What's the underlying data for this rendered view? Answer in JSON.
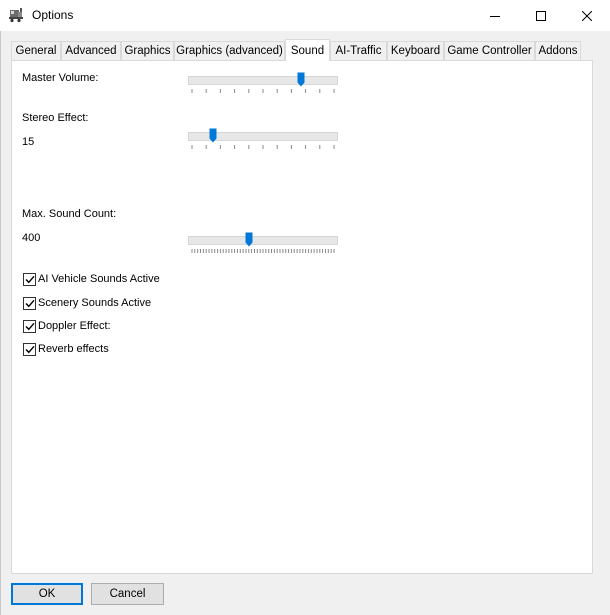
{
  "window": {
    "title": "Options",
    "app_icon": "train-icon",
    "controls": {
      "minimize_icon": "minimize-icon",
      "maximize_icon": "maximize-icon",
      "close_icon": "close-icon"
    }
  },
  "tabs": [
    {
      "label": "General",
      "active": false
    },
    {
      "label": "Advanced",
      "active": false
    },
    {
      "label": "Graphics",
      "active": false
    },
    {
      "label": "Graphics (advanced)",
      "active": false
    },
    {
      "label": "Sound",
      "active": true
    },
    {
      "label": "AI-Traffic",
      "active": false
    },
    {
      "label": "Keyboard",
      "active": false
    },
    {
      "label": "Game Controller",
      "active": false
    },
    {
      "label": "Addons",
      "active": false
    }
  ],
  "sound": {
    "master_volume": {
      "label": "Master Volume:",
      "level": 0.77
    },
    "stereo_effect": {
      "label": "Stereo Effect:",
      "value": "15",
      "level": 0.15
    },
    "max_sound_count": {
      "label": "Max. Sound Count:",
      "value": "400",
      "level": 0.4
    },
    "checkboxes": [
      {
        "label": "AI Vehicle Sounds Active",
        "checked": true
      },
      {
        "label": "Scenery Sounds Active",
        "checked": true
      },
      {
        "label": "Doppler Effect:",
        "checked": true
      },
      {
        "label": "Reverb effects",
        "checked": true
      }
    ]
  },
  "buttons": {
    "ok_label": "OK",
    "cancel_label": "Cancel"
  },
  "colors": {
    "accent": "#0078d7",
    "panel": "#ffffff",
    "background": "#f0f0f0"
  }
}
